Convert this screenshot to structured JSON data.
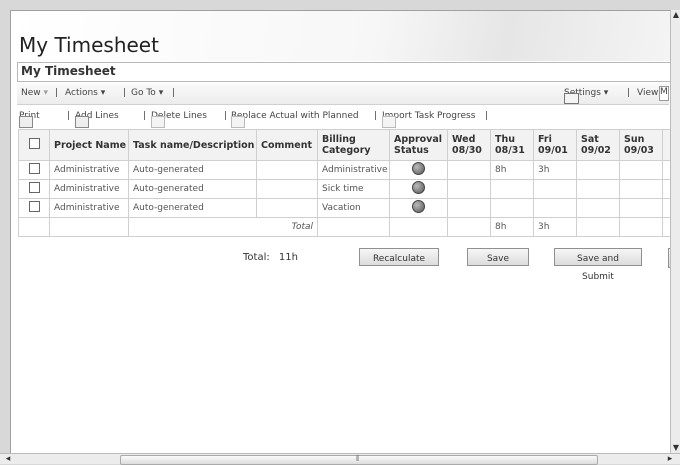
{
  "page": {
    "title": "My Timesheet",
    "subtitle": "My Timesheet"
  },
  "menubar": {
    "new": "New",
    "actions": "Actions",
    "goto": "Go To",
    "settings": "Settings",
    "view": "View:",
    "view_value": "M"
  },
  "toolbar": {
    "print": "Print",
    "add_lines": "Add Lines",
    "delete_lines": "Delete Lines",
    "replace": "Replace Actual with Planned",
    "import": "Import Task Progress"
  },
  "table": {
    "headers": {
      "project": "Project Name",
      "task": "Task name/Description",
      "comment": "Comment",
      "billing1": "Billing",
      "billing2": "Category",
      "approval1": "Approval",
      "approval2": "Status",
      "wed1": "Wed",
      "wed2": "08/30",
      "thu1": "Thu",
      "thu2": "08/31",
      "fri1": "Fri",
      "fri2": "09/01",
      "sat1": "Sat",
      "sat2": "09/02",
      "sun1": "Sun",
      "sun2": "09/03"
    },
    "rows": [
      {
        "project": "Administrative",
        "task": "Auto-generated",
        "comment": "",
        "billing": "Administrative",
        "wed": "",
        "thu": "8h",
        "fri": "3h",
        "sat": "",
        "sun": ""
      },
      {
        "project": "Administrative",
        "task": "Auto-generated",
        "comment": "",
        "billing": "Sick time",
        "wed": "",
        "thu": "",
        "fri": "",
        "sat": "",
        "sun": ""
      },
      {
        "project": "Administrative",
        "task": "Auto-generated",
        "comment": "",
        "billing": "Vacation",
        "wed": "",
        "thu": "",
        "fri": "",
        "sat": "",
        "sun": ""
      }
    ],
    "total_row": {
      "label": "Total",
      "thu": "8h",
      "fri": "3h"
    }
  },
  "footer": {
    "total_label": "Total:",
    "total_value": "11h",
    "recalculate": "Recalculate",
    "save": "Save",
    "save_submit": "Save and Submit"
  },
  "icons": {
    "print": "printer-icon",
    "add": "add-lines-icon",
    "delete": "delete-lines-icon",
    "replace": "replace-icon",
    "import": "import-icon",
    "settings": "settings-icon",
    "status": "status-dot-icon"
  }
}
